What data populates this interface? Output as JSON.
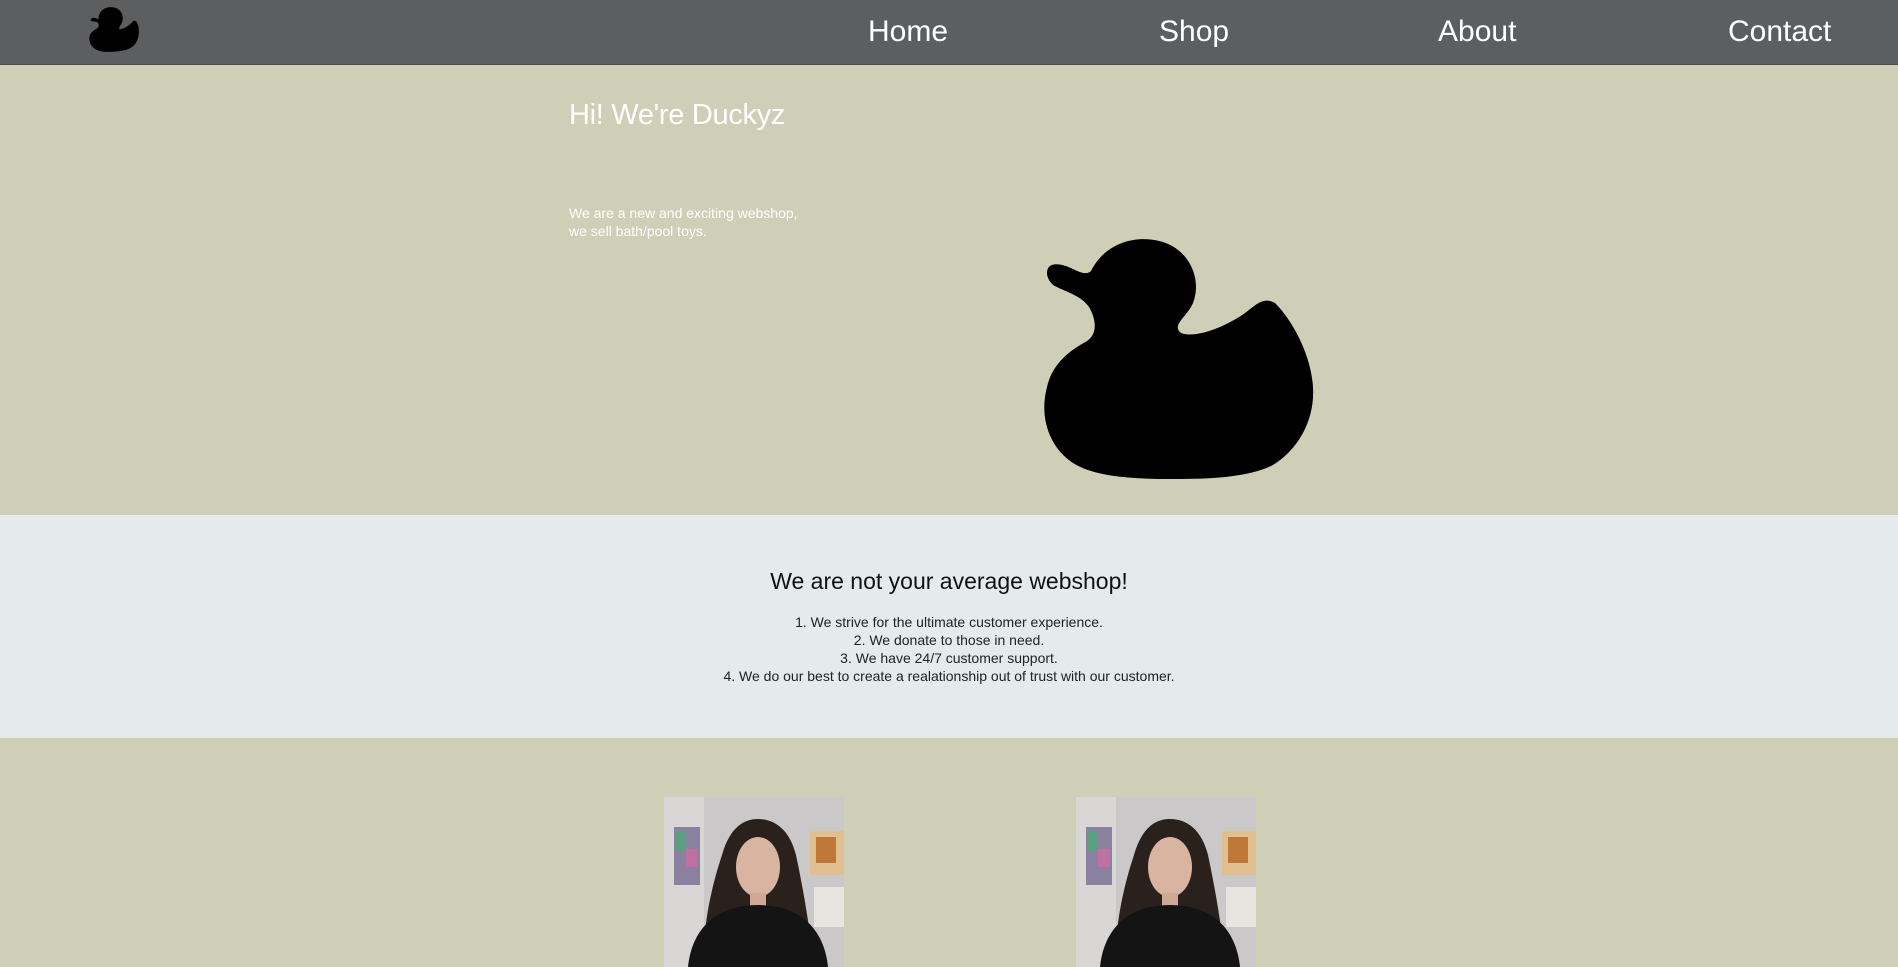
{
  "nav": {
    "logo_icon": "duck-icon",
    "items": [
      {
        "label": "Home"
      },
      {
        "label": "Shop"
      },
      {
        "label": "About"
      },
      {
        "label": "Contact"
      }
    ]
  },
  "hero": {
    "title": "Hi! We're Duckyz",
    "description_lines": [
      "We are a new and exciting webshop,",
      "we sell bath/pool toys."
    ],
    "image_icon": "duck-icon"
  },
  "features": {
    "title": "We are not your average webshop!",
    "items": [
      "1. We strive for the ultimate customer experience.",
      "2. We donate to those in need.",
      "3. We have 24/7 customer support.",
      "4. We do our best to create a realationship out of trust with our customer."
    ]
  },
  "team": {
    "photos": [
      {
        "icon": "person-photo"
      },
      {
        "icon": "person-photo"
      }
    ]
  },
  "colors": {
    "nav_bg": "#5d5e60",
    "hero_bg": "#cfcfb8",
    "features_bg": "#e5eaec",
    "text_light": "#ffffff"
  }
}
